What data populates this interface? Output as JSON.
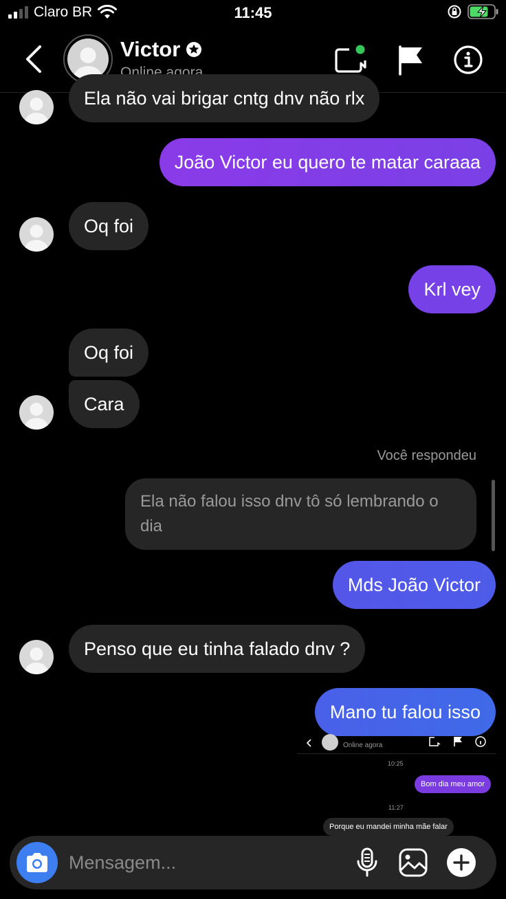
{
  "status_bar": {
    "carrier": "Claro BR",
    "time": "11:45"
  },
  "header": {
    "contact_name": "Victor",
    "contact_status": "Online agora"
  },
  "messages": [
    {
      "from": "them",
      "text": "Ela não vai brigar cntg dnv não rlx"
    },
    {
      "from": "me",
      "text": "João Victor eu quero te matar caraaa"
    },
    {
      "from": "them",
      "text": "Oq foi"
    },
    {
      "from": "me",
      "text": "Krl vey"
    },
    {
      "from": "them",
      "text": "Oq foi"
    },
    {
      "from": "them",
      "text": "Cara"
    },
    {
      "from": "me",
      "text": "Mds João Victor"
    },
    {
      "from": "them",
      "text": "Penso que eu tinha falado dnv ?"
    },
    {
      "from": "me",
      "text": "Mano tu falou isso"
    }
  ],
  "reply": {
    "label": "Você respondeu",
    "quoted_text": "Ela não falou isso dnv tô só lembrando o dia"
  },
  "embedded_screenshot": {
    "contact_status": "Online agora",
    "time_1": "10:25",
    "message_1": "Bom dia meu amor",
    "time_2": "11:27",
    "message_2": "Porque eu mandei minha mãe falar"
  },
  "composer": {
    "placeholder": "Mensagem..."
  },
  "colors": {
    "background": "#000000",
    "incoming_bubble": "#262626",
    "outgoing_gradient": [
      "#7c3ce6",
      "#6a45e6",
      "#4760e8",
      "#3f6ae8"
    ],
    "accent_blue": "#3d7ff0",
    "online_dot": "#35c759",
    "battery": "#4cd964"
  },
  "icons": [
    "back-chevron-icon",
    "verified-badge-icon",
    "video-call-icon",
    "flag-icon",
    "info-icon",
    "camera-icon",
    "microphone-icon",
    "gallery-icon",
    "plus-icon"
  ]
}
